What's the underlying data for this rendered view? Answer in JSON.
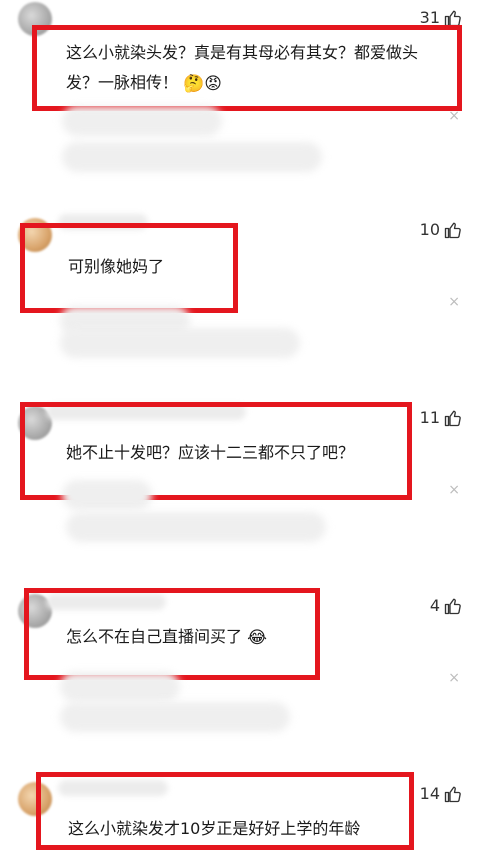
{
  "colors": {
    "highlight": "#e4161e",
    "text": "#1a1a1a",
    "muted": "#bdbdbd"
  },
  "comments": [
    {
      "likes": "31",
      "text_line1": "这么小就染头发？真是有其母必有其女？都爱做头",
      "text_line2": "发？一脉相传！",
      "emoji": [
        "🤔",
        "😡"
      ]
    },
    {
      "likes": "10",
      "text": "可别像她妈了"
    },
    {
      "likes": "11",
      "text": "她不止十发吧？应该十二三都不只了吧？"
    },
    {
      "likes": "4",
      "text": "怎么不在自己直播间买了",
      "emoji": "😂"
    },
    {
      "likes": "14",
      "text": "这么小就染发才10岁正是好好上学的年龄"
    }
  ],
  "icons": {
    "like": "thumb-up-icon",
    "close": "close-icon"
  },
  "close_glyph": "×"
}
